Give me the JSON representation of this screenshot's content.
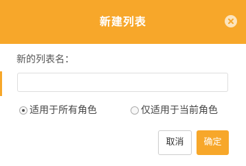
{
  "dialog": {
    "title": "新建列表",
    "close_icon": "close-icon",
    "name_label": "新的列表名：",
    "name_input": {
      "value": "",
      "placeholder": ""
    },
    "scope_options": [
      {
        "label": "适用于所有角色",
        "selected": true
      },
      {
        "label": "仅适用于当前角色",
        "selected": false
      }
    ],
    "buttons": {
      "cancel": "取消",
      "confirm": "确定"
    }
  },
  "colors": {
    "accent": "#f7a72a",
    "close_bg": "#fce4bd",
    "text": "#555555",
    "border": "#dddddd"
  }
}
